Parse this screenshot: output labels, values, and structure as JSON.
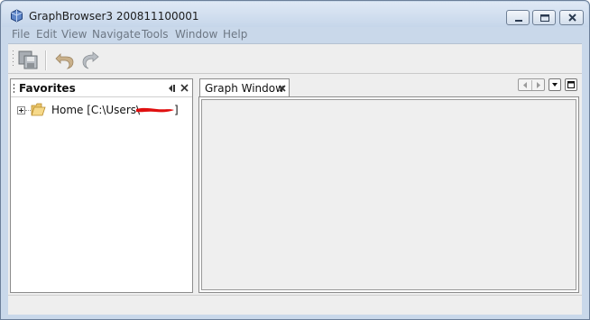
{
  "window": {
    "title": "GraphBrowser3 200811100001",
    "controls": {
      "minimize": "minimize-icon",
      "maximize": "maximize-icon",
      "close": "close-icon"
    }
  },
  "menu": {
    "items": [
      {
        "label": "File"
      },
      {
        "label": "Edit"
      },
      {
        "label": "View"
      },
      {
        "label": "Navigate"
      },
      {
        "label": "Tools"
      },
      {
        "label": "Window"
      },
      {
        "label": "Help"
      }
    ]
  },
  "toolbar": {
    "buttons": [
      {
        "icon": "save-all-icon",
        "enabled": false
      },
      {
        "icon": "undo-icon",
        "enabled": false
      },
      {
        "icon": "redo-icon",
        "enabled": false
      }
    ]
  },
  "favorites": {
    "title": "Favorites",
    "tree": [
      {
        "label": "Home [C:\\Users\\",
        "label_end": "]",
        "icon": "folder-icon",
        "expanded": false,
        "redacted": true
      }
    ]
  },
  "graph_window": {
    "tab_label": "Graph Window"
  },
  "colors": {
    "frame": "#c9d8ea",
    "client": "#eeeeee",
    "redaction": "#e01010"
  }
}
